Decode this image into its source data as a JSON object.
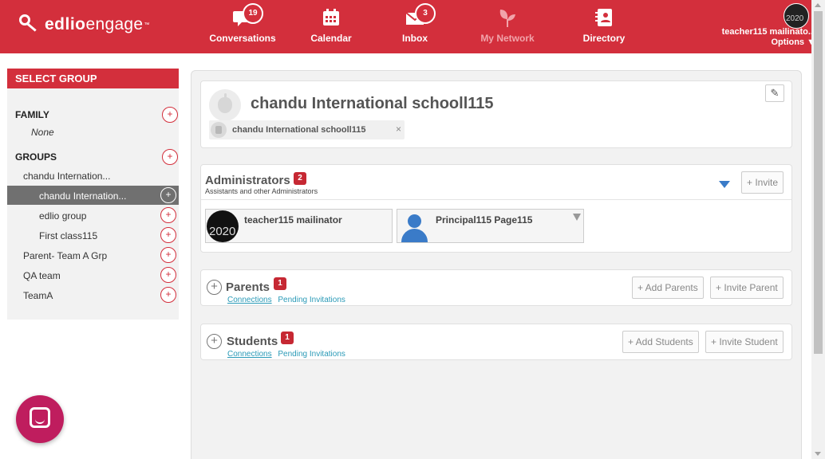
{
  "app": {
    "logo_bold": "edlio",
    "logo_light": "engage",
    "logo_tm": "™"
  },
  "nav": [
    {
      "label": "Conversations",
      "icon": "chat-icon",
      "badge": "19"
    },
    {
      "label": "Calendar",
      "icon": "calendar-icon",
      "badge": ""
    },
    {
      "label": "Inbox",
      "icon": "envelope-icon",
      "badge": "3"
    },
    {
      "label": "My Network",
      "icon": "leaf-icon",
      "badge": ""
    },
    {
      "label": "Directory",
      "icon": "directory-icon",
      "badge": ""
    }
  ],
  "user": {
    "name": "teacher115 mailinato...",
    "options": "Options ▼",
    "avatar_text": "2020"
  },
  "sidebar": {
    "title": "SELECT GROUP",
    "family_heading": "FAMILY",
    "family_none": "None",
    "groups_heading": "GROUPS",
    "groups": [
      {
        "label": "chandu Internation...",
        "level": 1,
        "active": false
      },
      {
        "label": "chandu Internation...",
        "level": 2,
        "active": true
      },
      {
        "label": "edlio group",
        "level": 2,
        "active": false
      },
      {
        "label": "First class115",
        "level": 2,
        "active": false
      },
      {
        "label": "Parent- Team A Grp",
        "level": 1,
        "active": false
      },
      {
        "label": "QA team",
        "level": 1,
        "active": false
      },
      {
        "label": "TeamA",
        "level": 1,
        "active": false
      }
    ],
    "plus": "+"
  },
  "school": {
    "title": "chandu International schooll115",
    "chip": "chandu International schooll115",
    "chip_close": "×",
    "edit_icon": "✎"
  },
  "administrators": {
    "title": "Administrators",
    "count": "2",
    "subtitle": "Assistants and other Administrators",
    "invite": "+ Invite",
    "members": [
      {
        "name": "teacher115 mailinator",
        "photo_text": "2020"
      },
      {
        "name": "Principal115 Page115"
      }
    ]
  },
  "parents": {
    "title": "Parents",
    "count": "1",
    "connections": "Connections",
    "pending": "Pending Invitations",
    "add": "+ Add Parents",
    "invite": "+ Invite Parent"
  },
  "students": {
    "title": "Students",
    "count": "1",
    "connections": "Connections",
    "pending": "Pending Invitations",
    "add": "+ Add Students",
    "invite": "+ Invite Student"
  },
  "colors": {
    "brand_red": "#d32f3c",
    "badge_red": "#c62833",
    "link_teal": "#2a9ab7",
    "accent_blue": "#3a7bc8",
    "chat_magenta": "#bf1d5e"
  }
}
